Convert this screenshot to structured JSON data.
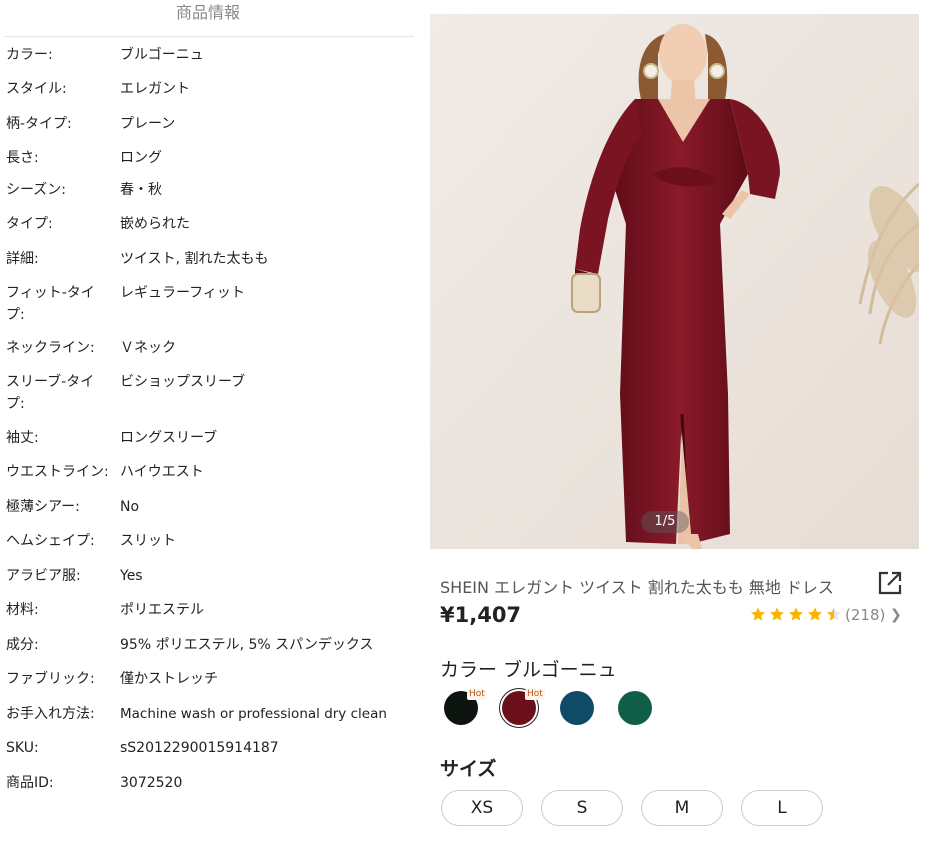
{
  "panel": {
    "title": "商品情報",
    "attributes": [
      {
        "label": "カラー:",
        "value": "ブルゴーニュ"
      },
      {
        "label": "スタイル:",
        "value": "エレガント"
      },
      {
        "label": "柄-タイプ:",
        "value": "プレーン"
      },
      {
        "label": "長さ:",
        "value": "ロング"
      },
      {
        "label": "シーズン:",
        "value": "春・秋"
      },
      {
        "label": "タイプ:",
        "value": "嵌められた"
      },
      {
        "label": "詳細:",
        "value": "ツイスト, 割れた太もも"
      },
      {
        "label": "フィット-タイプ:",
        "value": "レギュラーフィット"
      },
      {
        "label": "ネックライン:",
        "value": "Ｖネック"
      },
      {
        "label": "スリーブ-タイプ:",
        "value": "ビショップスリーブ"
      },
      {
        "label": "袖丈:",
        "value": "ロングスリーブ"
      },
      {
        "label": "ウエストライン:",
        "value": "ハイウエスト"
      },
      {
        "label": "極薄シアー:",
        "value": "No"
      },
      {
        "label": "ヘムシェイプ:",
        "value": "スリット"
      },
      {
        "label": "アラビア服:",
        "value": "Yes"
      },
      {
        "label": "材料:",
        "value": "ポリエステル"
      },
      {
        "label": "成分:",
        "value": "95% ポリエステル, 5% スパンデックス"
      },
      {
        "label": "ファブリック:",
        "value": "僅かストレッチ"
      },
      {
        "label": "お手入れ方法:",
        "value": "Machine wash or professional dry clean"
      },
      {
        "label": "SKU:",
        "value": "sS2012290015914187"
      },
      {
        "label": "商品ID:",
        "value": "3072520"
      }
    ]
  },
  "product": {
    "image_counter": "1/5",
    "title": "SHEIN エレガント ツイスト 割れた太もも 無地 ドレス",
    "price": "¥1,407",
    "rating": {
      "stars": 4.5,
      "count": "(218)"
    },
    "color_label": "カラー ブルゴーニュ",
    "hot_badge": "Hot",
    "swatches": [
      {
        "color": "#0d1410",
        "hot": true,
        "selected": false
      },
      {
        "color": "#6b0f1a",
        "hot": true,
        "selected": true
      },
      {
        "color": "#0f4a66",
        "hot": false,
        "selected": false
      },
      {
        "color": "#0f5e48",
        "hot": false,
        "selected": false
      }
    ],
    "size_label": "サイズ",
    "sizes": [
      "XS",
      "S",
      "M",
      "L"
    ]
  },
  "colors": {
    "star": "#f7b500",
    "dress": "#7b1422"
  },
  "icons": {
    "share": "share-external-icon",
    "star": "star-icon",
    "chevron": "chevron-right-icon"
  }
}
